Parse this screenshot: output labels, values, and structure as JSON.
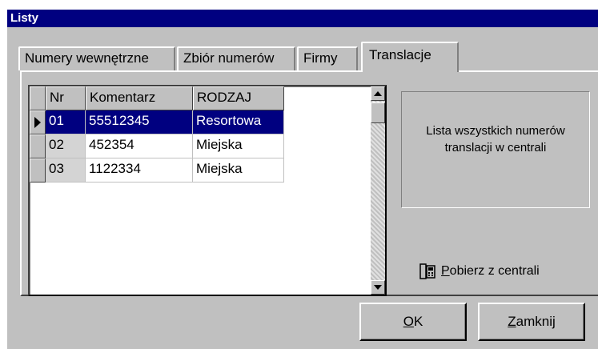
{
  "window": {
    "title": "Listy"
  },
  "tabs": [
    {
      "label": "Numery wewnętrzne",
      "active": false
    },
    {
      "label": "Zbiór numerów",
      "active": false
    },
    {
      "label": "Firmy",
      "active": false
    },
    {
      "label": "Translacje",
      "active": true
    }
  ],
  "grid": {
    "columns": [
      "Nr",
      "Komentarz",
      "RODZAJ"
    ],
    "rows": [
      {
        "nr": "01",
        "komentarz": "55512345",
        "rodzaj": "Resortowa",
        "selected": true
      },
      {
        "nr": "02",
        "komentarz": "452354",
        "rodzaj": "Miejska",
        "selected": false
      },
      {
        "nr": "03",
        "komentarz": "1122334",
        "rodzaj": "Miejska",
        "selected": false
      }
    ]
  },
  "info": {
    "line1": "Lista wszystkich numerów",
    "line2": "translacji w centrali"
  },
  "fetch": {
    "first": "P",
    "rest": "obierz z centrali",
    "icon": "phone-icon"
  },
  "buttons": {
    "ok_first": "O",
    "ok_rest": "K",
    "close_first": "Z",
    "close_rest": "amknij"
  },
  "colors": {
    "titlebar": "#000080",
    "selection": "#000080",
    "face": "#c0c0c0"
  }
}
